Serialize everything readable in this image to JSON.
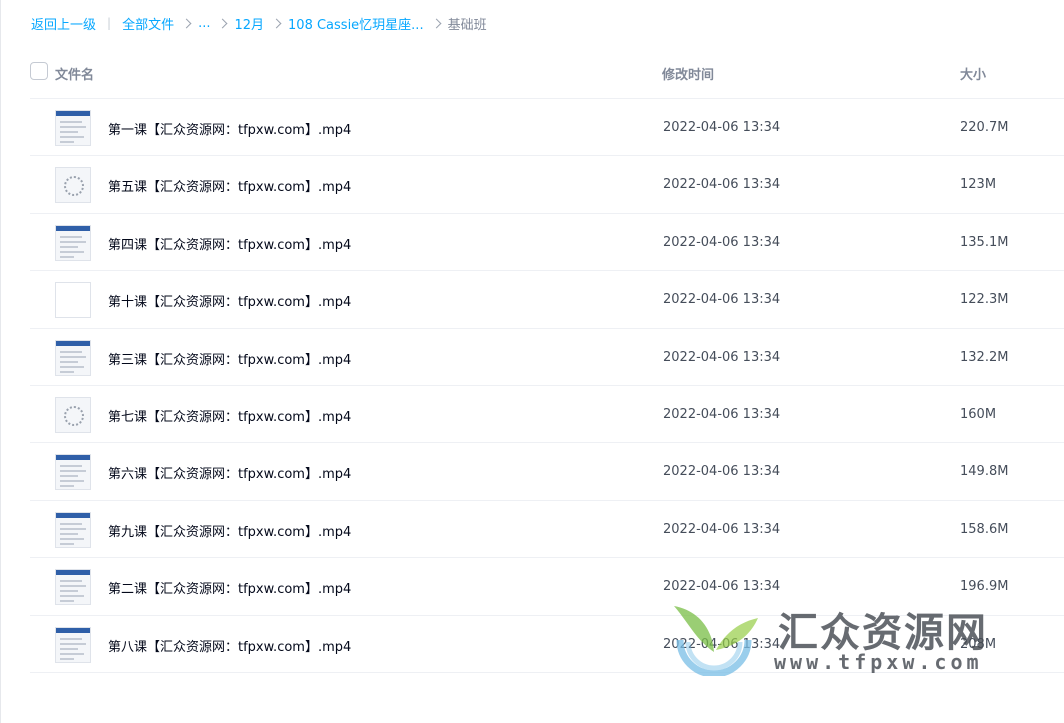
{
  "breadcrumb": {
    "back": "返回上一级",
    "items": [
      "全部文件",
      "...",
      "12月",
      "108 Cassie忆玥星座..."
    ],
    "current": "基础班"
  },
  "header": {
    "name": "文件名",
    "time": "修改时间",
    "size": "大小"
  },
  "files": [
    {
      "name": "第一课【汇众资源网：tfpxw.com】.mp4",
      "time": "2022-04-06 13:34",
      "size": "220.7M",
      "thumb": "screen"
    },
    {
      "name": "第五课【汇众资源网：tfpxw.com】.mp4",
      "time": "2022-04-06 13:34",
      "size": "123M",
      "thumb": "chart-wheel"
    },
    {
      "name": "第四课【汇众资源网：tfpxw.com】.mp4",
      "time": "2022-04-06 13:34",
      "size": "135.1M",
      "thumb": "screen"
    },
    {
      "name": "第十课【汇众资源网：tfpxw.com】.mp4",
      "time": "2022-04-06 13:34",
      "size": "122.3M",
      "thumb": "blank"
    },
    {
      "name": "第三课【汇众资源网：tfpxw.com】.mp4",
      "time": "2022-04-06 13:34",
      "size": "132.2M",
      "thumb": "screen"
    },
    {
      "name": "第七课【汇众资源网：tfpxw.com】.mp4",
      "time": "2022-04-06 13:34",
      "size": "160M",
      "thumb": "chart-wheel"
    },
    {
      "name": "第六课【汇众资源网：tfpxw.com】.mp4",
      "time": "2022-04-06 13:34",
      "size": "149.8M",
      "thumb": "screen"
    },
    {
      "name": "第九课【汇众资源网：tfpxw.com】.mp4",
      "time": "2022-04-06 13:34",
      "size": "158.6M",
      "thumb": "screen"
    },
    {
      "name": "第二课【汇众资源网：tfpxw.com】.mp4",
      "time": "2022-04-06 13:34",
      "size": "196.9M",
      "thumb": "screen"
    },
    {
      "name": "第八课【汇众资源网：tfpxw.com】.mp4",
      "time": "2022-04-06 13:34",
      "size": "208M",
      "thumb": "screen"
    }
  ],
  "watermark": {
    "brand": "汇众资源网",
    "url": "www.tfpxw.com"
  },
  "colors": {
    "link": "#06a7ff",
    "muted": "#818999",
    "text": "#03081a"
  }
}
